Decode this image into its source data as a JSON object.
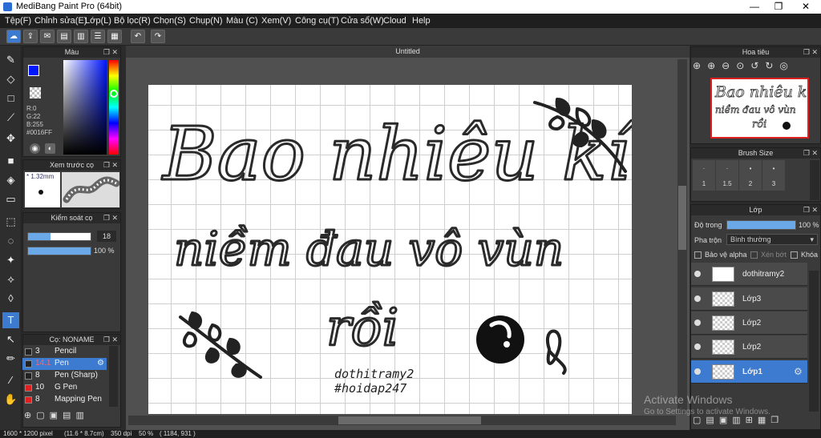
{
  "window": {
    "title": "MediBang Paint Pro (64bit)",
    "minimize": "—",
    "maximize": "❐",
    "close": "✕"
  },
  "menu": [
    "Tệp(F)",
    "Chỉnh sửa(E)",
    "Lớp(L)",
    "Bộ lọc(R)",
    "Chọn(S)",
    "Chụp(N)",
    "Màu (C)",
    "Xem(V)",
    "Công cụ(T)",
    "Cửa sổ(W)",
    "Cloud",
    "Help"
  ],
  "document": {
    "tab": "Untitled"
  },
  "color_panel": {
    "title": "Màu",
    "r": "R:0",
    "g": "G:22",
    "b": "B:255",
    "hex": "#0016FF",
    "color": "#0016ff"
  },
  "brush_preview": {
    "title": "Xem trước cọ",
    "size": "1.32mm"
  },
  "brush_control": {
    "title": "Kiểm soát cọ",
    "size_value": "18",
    "opacity_value": "100 %"
  },
  "brush_list": {
    "title": "Cọ: NONAME",
    "items": [
      {
        "num": "3",
        "name": "Pencil",
        "color": "#222222"
      },
      {
        "num": "14.1",
        "name": "Pen",
        "color": "#222222"
      },
      {
        "num": "8",
        "name": "Pen (Sharp)",
        "color": "#222222"
      },
      {
        "num": "10",
        "name": "G Pen",
        "color": "#e02020"
      },
      {
        "num": "8",
        "name": "Mapping Pen",
        "color": "#e02020"
      }
    ]
  },
  "navigator": {
    "title": "Hoa tiêu"
  },
  "brush_size": {
    "title": "Brush Size",
    "sizes": [
      "1",
      "1.5",
      "2",
      "3"
    ]
  },
  "layer_panel": {
    "title": "Lớp",
    "opacity_label": "Độ trong",
    "opacity_value": "100 %",
    "blend_label": "Pha trộn",
    "blend_value": "Bình thường",
    "protect_alpha": "Bảo vệ alpha",
    "clipping": "Xén bớt",
    "lock": "Khóa",
    "layers": [
      "dothitramy2",
      "Lớp3",
      "Lớp2",
      "Lớp2",
      "Lớp1"
    ]
  },
  "canvas_text": {
    "line1": "Bao nhiêu kí",
    "line2": "niềm đau vô vùn",
    "line3": "rồi",
    "sig1": "dothitramy2",
    "sig2": "#hoidap247"
  },
  "watermark": {
    "line1": "Activate Windows",
    "line2": "Go to Settings to activate Windows."
  },
  "status": {
    "pixels": "1600 * 1200 pixel",
    "cm": "(11.6 * 8.7cm)",
    "dpi": "350 dpi",
    "zoom": "50 %",
    "coords": "( 1184, 931 )"
  }
}
